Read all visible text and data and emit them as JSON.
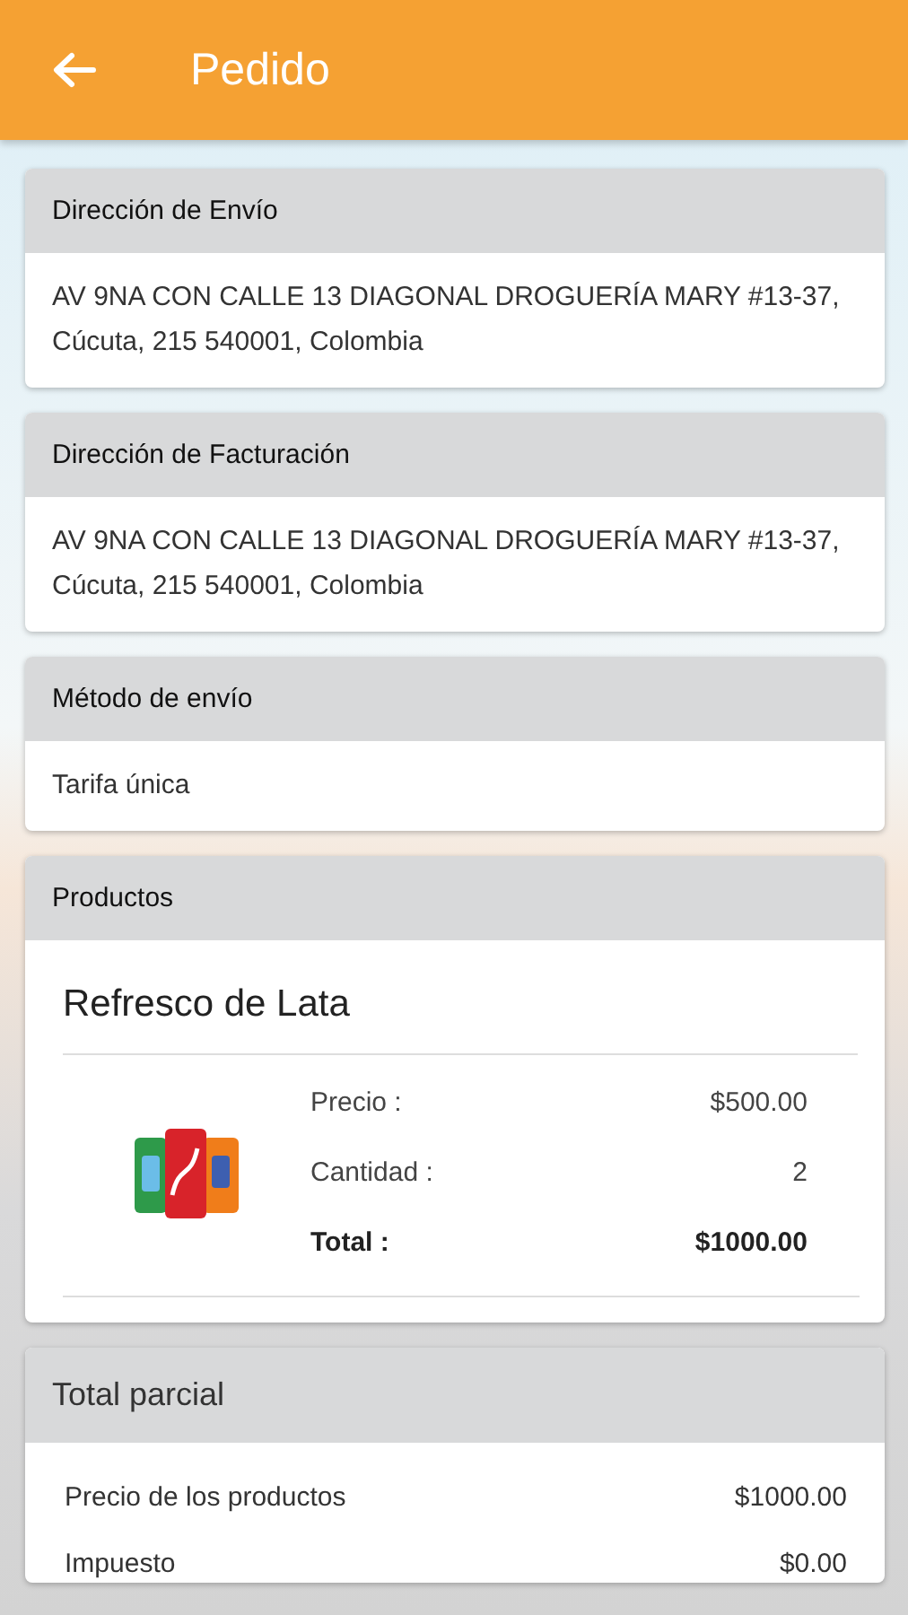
{
  "app_bar": {
    "title": "Pedido"
  },
  "sections": [
    {
      "kind": "text",
      "title": "Dirección de Envío",
      "text": "AV 9NA CON CALLE 13 DIAGONAL DROGUERÍA MARY #13-37, Cúcuta, 215 540001, Colombia"
    },
    {
      "kind": "text",
      "title": "Dirección de Facturación",
      "text": "AV 9NA CON CALLE 13 DIAGONAL DROGUERÍA MARY #13-37, Cúcuta, 215 540001, Colombia"
    },
    {
      "kind": "text",
      "title": "Método de envío",
      "text": "Tarifa única"
    },
    {
      "kind": "products",
      "title": "Productos",
      "products": [
        {
          "name": "Refresco de Lata",
          "details": [
            {
              "label": "Precio :",
              "value": "$500.00",
              "emphasis": false
            },
            {
              "label": "Cantidad :",
              "value": "2",
              "emphasis": false
            },
            {
              "label": "Total :",
              "value": "$1000.00",
              "emphasis": true
            }
          ]
        }
      ]
    },
    {
      "kind": "summary",
      "title": "Total parcial",
      "rows": [
        {
          "label": "Precio de los productos",
          "value": "$1000.00"
        },
        {
          "label": "Impuesto",
          "value": "$0.00"
        }
      ]
    }
  ]
}
